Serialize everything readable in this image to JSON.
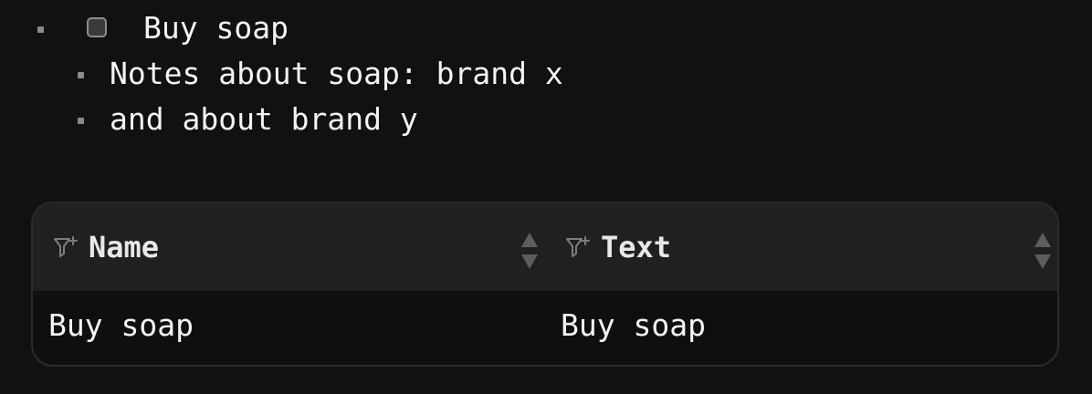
{
  "outline": {
    "todo_item": {
      "label": "Buy soap",
      "checked": false
    },
    "children": [
      {
        "text": "Notes about soap: brand x"
      },
      {
        "text": "and about brand y"
      }
    ]
  },
  "table": {
    "columns": [
      {
        "label": "Name",
        "filter_icon": "filter-add-icon",
        "sort_icon": "sort-updown-icon"
      },
      {
        "label": "Text",
        "filter_icon": "filter-add-icon",
        "sort_icon": "sort-updown-icon"
      }
    ],
    "rows": [
      {
        "name": "Buy soap",
        "text": "Buy soap"
      }
    ]
  },
  "colors": {
    "background": "#111111",
    "header_bg": "#202020",
    "border": "#2b2b2b",
    "text": "#f4f4f4",
    "muted": "#8a8a8a"
  }
}
